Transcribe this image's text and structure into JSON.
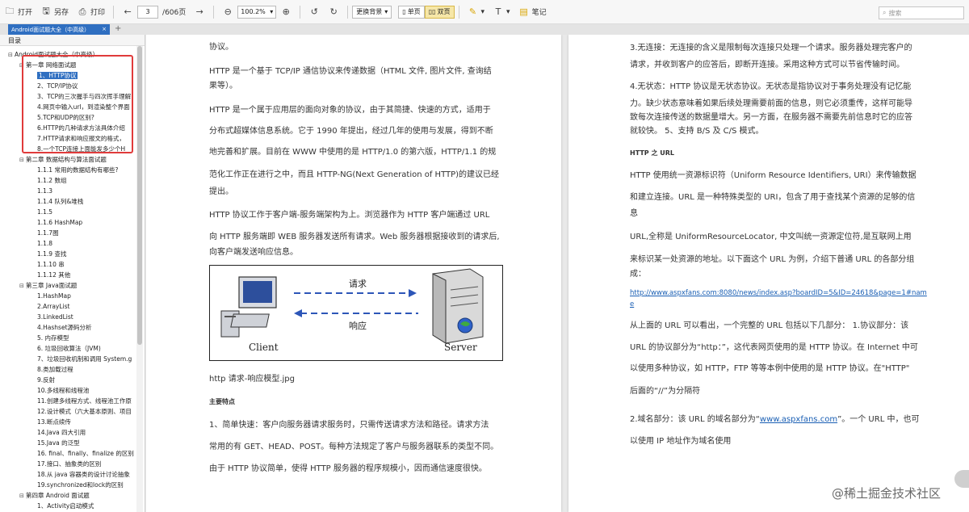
{
  "toolbar": {
    "open": "打开",
    "save_as": "另存",
    "print": "打印",
    "page_current": "3",
    "page_total": "/606页",
    "zoom": "100.2%",
    "background": "更换背景",
    "single_page": "单页",
    "double_page": "双页",
    "notes": "笔记",
    "search_placeholder": "搜索"
  },
  "tab": {
    "title": "Android面试题大全（中高级）",
    "close": "×",
    "add": "+"
  },
  "sidebar": {
    "title": "目录",
    "items": [
      {
        "label": "Android面试题大全（中高级）",
        "level": 0,
        "toggle": "⊟"
      },
      {
        "label": "第一章 网络面试题",
        "level": 1,
        "toggle": "⊟"
      },
      {
        "label": "1、HTTP协议",
        "level": 2,
        "toggle": "",
        "selected": true
      },
      {
        "label": "2、TCP/IP协议",
        "level": 2,
        "toggle": ""
      },
      {
        "label": "3、TCP的三次握手与四次挥手理解",
        "level": 2,
        "toggle": ""
      },
      {
        "label": "4.网页中输入url，到渲染整个界面",
        "level": 2,
        "toggle": ""
      },
      {
        "label": "5.TCP和UDP的区别?",
        "level": 2,
        "toggle": ""
      },
      {
        "label": "6.HTTP的几种请求方法具体介绍",
        "level": 2,
        "toggle": ""
      },
      {
        "label": "7.HTTP请求和响应报文的格式，",
        "level": 2,
        "toggle": ""
      },
      {
        "label": "8.一个TCP连接上面能发多少个H",
        "level": 2,
        "toggle": ""
      },
      {
        "label": "第二章 数据结构与算法面试题",
        "level": 1,
        "toggle": "⊟"
      },
      {
        "label": "1.1.1 常用的数据结构有哪些?",
        "level": 2,
        "toggle": ""
      },
      {
        "label": "1.1.2 数组",
        "level": 2,
        "toggle": ""
      },
      {
        "label": "1.1.3",
        "level": 2,
        "toggle": ""
      },
      {
        "label": "1.1.4 队列&堆栈",
        "level": 2,
        "toggle": ""
      },
      {
        "label": "1.1.5",
        "level": 2,
        "toggle": ""
      },
      {
        "label": "1.1.6 HashMap",
        "level": 2,
        "toggle": ""
      },
      {
        "label": "1.1.7图",
        "level": 2,
        "toggle": ""
      },
      {
        "label": "1.1.8",
        "level": 2,
        "toggle": ""
      },
      {
        "label": "1.1.9 查找",
        "level": 2,
        "toggle": ""
      },
      {
        "label": "1.1.10 串",
        "level": 2,
        "toggle": ""
      },
      {
        "label": "1.1.12 其他",
        "level": 2,
        "toggle": ""
      },
      {
        "label": "第三章 Java面试题",
        "level": 1,
        "toggle": "⊟"
      },
      {
        "label": "1.HashMap",
        "level": 2,
        "toggle": ""
      },
      {
        "label": "2.ArrayList",
        "level": 2,
        "toggle": ""
      },
      {
        "label": "3.LinkedList",
        "level": 2,
        "toggle": ""
      },
      {
        "label": "4.Hashset源码分析",
        "level": 2,
        "toggle": ""
      },
      {
        "label": "5. 内存模型",
        "level": 2,
        "toggle": ""
      },
      {
        "label": "6. 垃圾回收算法（JVM)",
        "level": 2,
        "toggle": ""
      },
      {
        "label": "7、垃圾回收机制和调用 System.g",
        "level": 2,
        "toggle": ""
      },
      {
        "label": "8.类加载过程",
        "level": 2,
        "toggle": ""
      },
      {
        "label": "9.反射",
        "level": 2,
        "toggle": ""
      },
      {
        "label": "10.多线程和线程池",
        "level": 2,
        "toggle": ""
      },
      {
        "label": "11.创建多线程方式、线程池工作原",
        "level": 2,
        "toggle": ""
      },
      {
        "label": "12.设计模式（六大基本原则、项目",
        "level": 2,
        "toggle": ""
      },
      {
        "label": "13.断点续传",
        "level": 2,
        "toggle": ""
      },
      {
        "label": "14.Java 四大引用",
        "level": 2,
        "toggle": ""
      },
      {
        "label": "15.Java 的泛型",
        "level": 2,
        "toggle": ""
      },
      {
        "label": "16. final、finally、finalize 的区别",
        "level": 2,
        "toggle": ""
      },
      {
        "label": "17.接口、抽象类的区别",
        "level": 2,
        "toggle": ""
      },
      {
        "label": "18.从 java 容器类的设计讨论抽象",
        "level": 2,
        "toggle": ""
      },
      {
        "label": "19.synchronized和lock的区别",
        "level": 2,
        "toggle": ""
      },
      {
        "label": "第四章 Android 面试题",
        "level": 1,
        "toggle": "⊟"
      },
      {
        "label": "1、Activity启动模式",
        "level": 2,
        "toggle": ""
      }
    ]
  },
  "left_page": {
    "p0": "协议。",
    "p1a": "HTTP 是一个基于 TCP/IP 通信协议来传递数据（HTML  文件, 图片文件, 查询结",
    "p1b": "果等）。",
    "p2a": "HTTP 是一个属于应用层的面向对象的协议，由于其简捷、快速的方式，适用于",
    "p2b": "分布式超媒体信息系统。它于 1990 年提出，经过几年的使用与发展，得到不断",
    "p2c": "地完善和扩展。目前在 WWW 中使用的是 HTTP/1.0 的第六版，HTTP/1.1 的规",
    "p2d": "范化工作正在进行之中，而且 HTTP-NG(Next Generation of HTTP)的建议已经",
    "p2e": "提出。",
    "p3a": "HTTP 协议工作于客户端-服务端架构为上。浏览器作为 HTTP 客户端通过 URL",
    "p3b": "向 HTTP 服务端即 WEB 服务器发送所有请求。Web 服务器根据接收到的请求后,",
    "p3c": "向客户端发送响应信息。",
    "diagram": {
      "client": "Client",
      "server": "Server",
      "request": "请求",
      "response": "响应"
    },
    "caption": "http 请求-响应模型.jpg",
    "heading": "主要特点",
    "p4a": "1、简单快速：客户向服务器请求服务时，只需传送请求方法和路径。请求方法",
    "p4b": "常用的有 GET、HEAD、POST。每种方法规定了客户与服务器联系的类型不同。",
    "p4c": "由于 HTTP 协议简单，使得 HTTP 服务器的程序规模小，因而通信速度很快。"
  },
  "right_page": {
    "r1a": "3.无连接：无连接的含义是限制每次连接只处理一个请求。服务器处理完客户的",
    "r1b": "请求，并收到客户的应答后，即断开连接。采用这种方式可以节省传输时间。",
    "r2a": "4.无状态：HTTP 协议是无状态协议。无状态是指协议对于事务处理没有记忆能",
    "r2b": "力。缺少状态意味着如果后续处理需要前面的信息，则它必须重传，这样可能导",
    "r2c": "致每次连接传送的数据量增大。另一方面，在服务器不需要先前信息时它的应答",
    "r2d": "就较快。 5、支持 B/S 及 C/S 模式。",
    "heading": "HTTP 之 URL",
    "r3a": "HTTP 使用统一资源标识符（Uniform Resource Identifiers, URI）来传输数据",
    "r3b": "和建立连接。URL 是一种特殊类型的 URI，包含了用于查找某个资源的足够的信",
    "r3c": "息",
    "r4a": "URL,全称是 UniformResourceLocator, 中文叫统一资源定位符,是互联网上用",
    "r4b": "来标识某一处资源的地址。以下面这个 URL 为例，介绍下普通 URL 的各部分组",
    "r4c": "成：",
    "url_a": "http://www.aspxfans.com:8080/news/index.asp?boardID=5&ID=24618&page=1#nam",
    "url_b": "e",
    "r5a": "从上面的 URL 可以看出，一个完整的 URL 包括以下几部分：  1.协议部分：该",
    "r5b": "URL 的协议部分为“http：”，这代表网页使用的是 HTTP 协议。在 Internet 中可",
    "r5c": "以使用多种协议，如 HTTP，FTP 等等本例中使用的是 HTTP 协议。在\"HTTP\"",
    "r5d": "后面的“//”为分隔符",
    "r6a_pre": "2.域名部分：该 URL 的域名部分为“",
    "r6a_link": "www.aspxfans.com",
    "r6a_post": "”。一个 URL 中，也可",
    "r6b": "以使用 IP 地址作为域名使用"
  },
  "watermark": "@稀土掘金技术社区"
}
